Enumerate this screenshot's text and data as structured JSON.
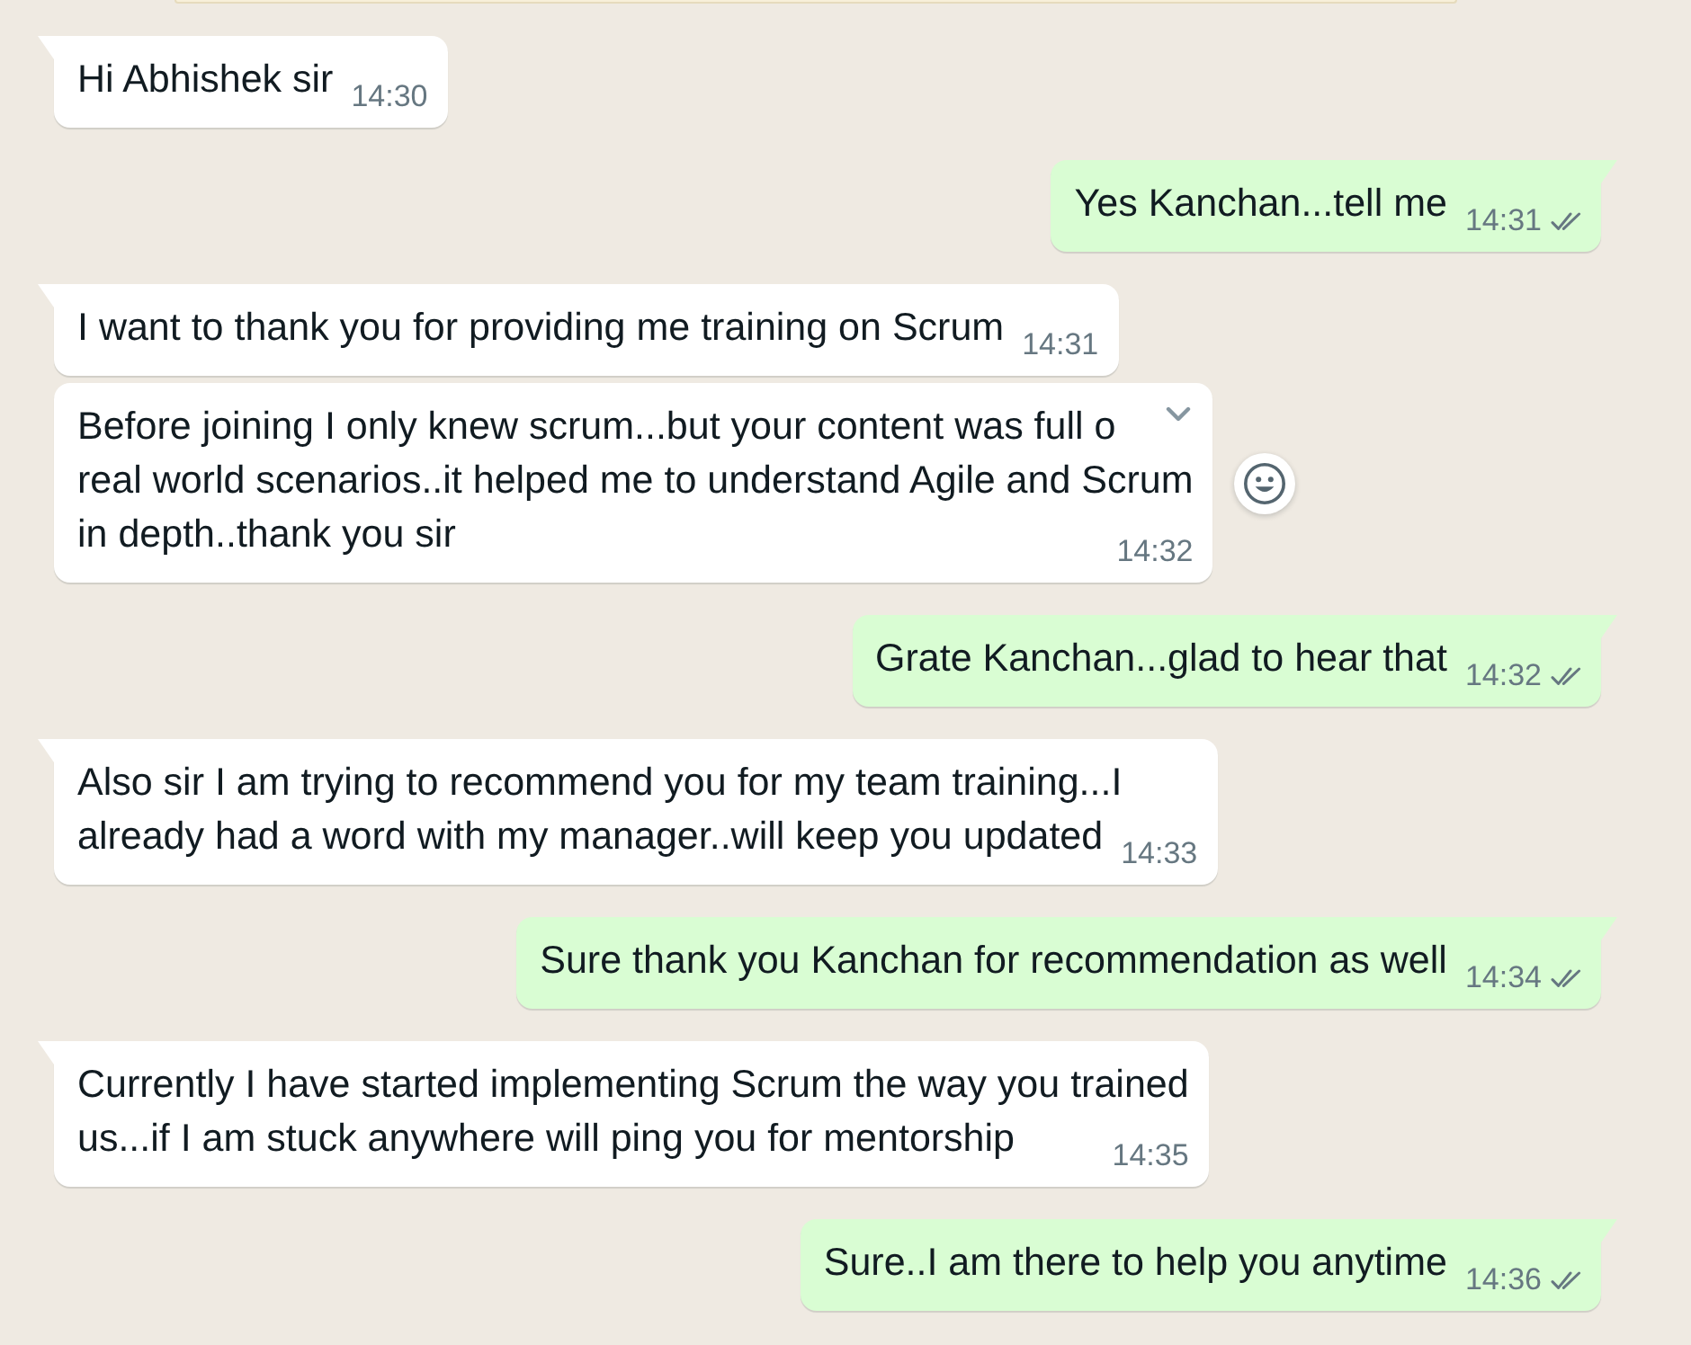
{
  "messages": [
    {
      "kind": "incoming",
      "tail": true,
      "hovered": false,
      "lines": [
        "Hi Abhishek sir"
      ],
      "time": "14:30"
    },
    {
      "kind": "outgoing",
      "tail": true,
      "lines": [
        "Yes Kanchan...tell me"
      ],
      "time": "14:31",
      "read": false
    },
    {
      "kind": "incoming",
      "tail": true,
      "hovered": false,
      "lines": [
        "I want to thank you for providing me training on Scrum"
      ],
      "time": "14:31"
    },
    {
      "kind": "incoming",
      "tail": false,
      "hovered": true,
      "lines": [
        "Before joining I only knew scrum...but your content was full o",
        "real world scenarios..it helped me to understand Agile and Scrum",
        "in depth..thank you sir"
      ],
      "time": "14:32"
    },
    {
      "kind": "outgoing",
      "tail": true,
      "lines": [
        "Grate Kanchan...glad to hear that"
      ],
      "time": "14:32",
      "read": false
    },
    {
      "kind": "incoming",
      "tail": true,
      "hovered": false,
      "lines": [
        "Also sir I am trying to recommend you for my team training...I",
        "already had a word with my manager..will keep you updated"
      ],
      "time": "14:33"
    },
    {
      "kind": "outgoing",
      "tail": true,
      "lines": [
        "Sure thank you Kanchan for recommendation as well"
      ],
      "time": "14:34",
      "read": false
    },
    {
      "kind": "incoming",
      "tail": true,
      "hovered": false,
      "lines": [
        "Currently I have started implementing Scrum the way you trained",
        "us...if I am stuck anywhere will ping you for mentorship"
      ],
      "time": "14:35"
    },
    {
      "kind": "outgoing",
      "tail": true,
      "lines": [
        "Sure..I am there to help you anytime"
      ],
      "time": "14:36",
      "read": false
    }
  ]
}
